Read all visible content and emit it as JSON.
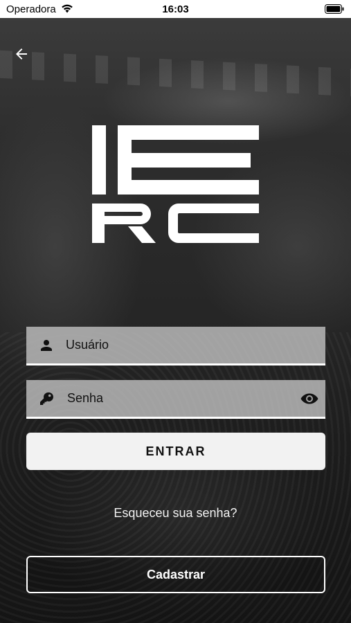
{
  "status_bar": {
    "carrier": "Operadora",
    "time": "16:03",
    "icons": [
      "wifi-icon",
      "battery-icon"
    ]
  },
  "nav": {
    "back_icon": "arrow-left-icon"
  },
  "logo": {
    "text": "IERC"
  },
  "login_form": {
    "username": {
      "placeholder": "Usuário",
      "icon": "user-icon"
    },
    "password": {
      "placeholder": "Senha",
      "icon": "key-icon",
      "toggle_icon": "eye-icon"
    },
    "submit_label": "ENTRAR",
    "forgot_label": "Esqueceu sua senha?",
    "register_label": "Cadastrar"
  },
  "colors": {
    "field_background": "#bebebe",
    "button_background": "#f2f2f2",
    "text_light": "#ffffff"
  }
}
